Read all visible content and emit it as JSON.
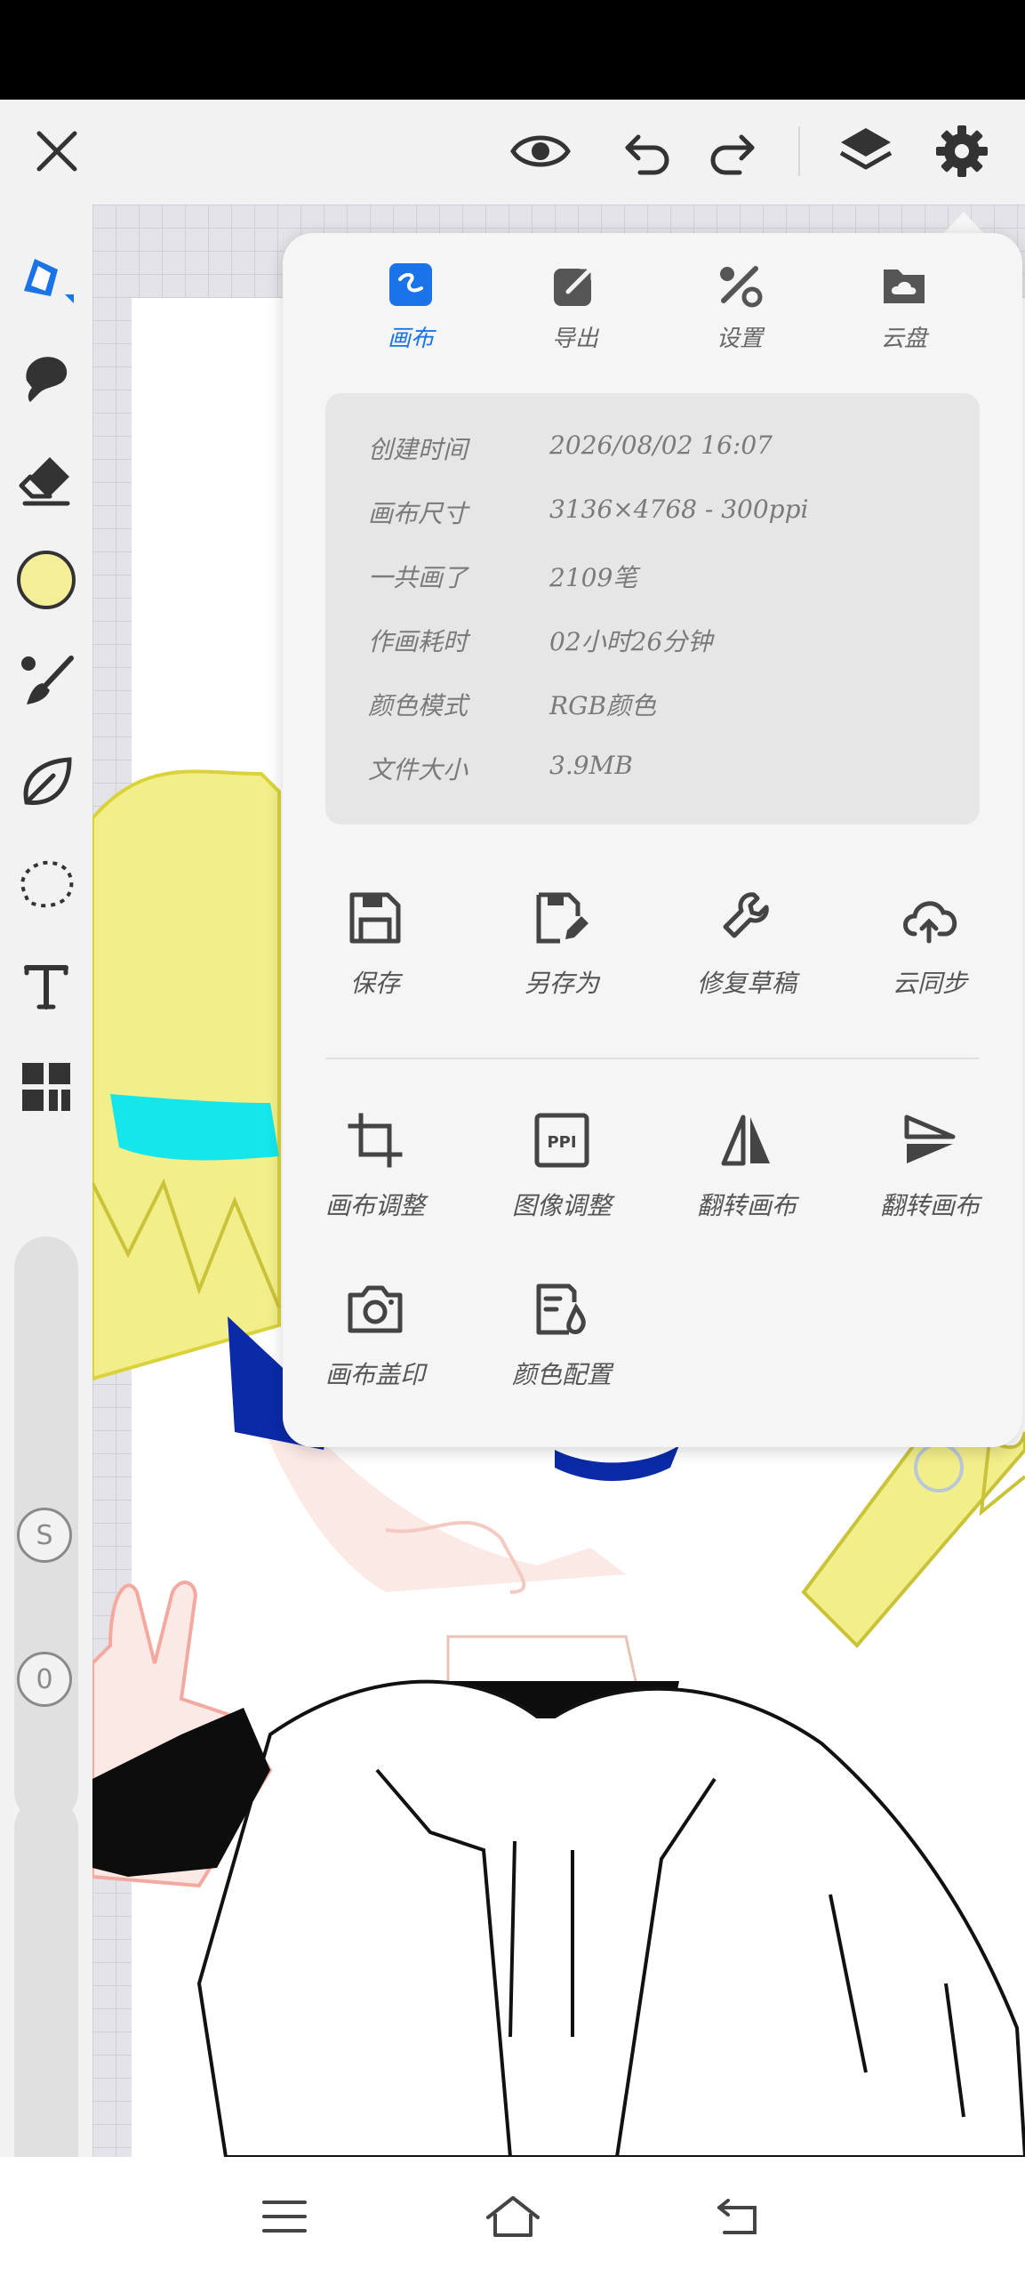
{
  "popup": {
    "tabs": [
      {
        "label": "画布",
        "icon": "canvas-icon",
        "active": true
      },
      {
        "label": "导出",
        "icon": "export-icon"
      },
      {
        "label": "设置",
        "icon": "settings-tools-icon"
      },
      {
        "label": "云盘",
        "icon": "cloud-drive-icon"
      }
    ],
    "info": [
      {
        "key": "创建时间",
        "value": "2026/08/02 16:07"
      },
      {
        "key": "画布尺寸",
        "value": "3136×4768 - 300ppi"
      },
      {
        "key": "一共画了",
        "value": "2109笔"
      },
      {
        "key": "作画耗时",
        "value": "02小时26分钟"
      },
      {
        "key": "颜色模式",
        "value": "RGB颜色"
      },
      {
        "key": "文件大小",
        "value": "3.9MB"
      }
    ],
    "actions_row1": [
      {
        "label": "保存",
        "icon": "save-icon"
      },
      {
        "label": "另存为",
        "icon": "save-as-icon"
      },
      {
        "label": "修复草稿",
        "icon": "wrench-icon"
      },
      {
        "label": "云同步",
        "icon": "cloud-sync-icon"
      }
    ],
    "actions_row2": [
      {
        "label": "画布调整",
        "icon": "crop-icon"
      },
      {
        "label": "图像调整",
        "icon": "ppi-icon"
      },
      {
        "label": "翻转画布",
        "icon": "flip-horizontal-icon"
      },
      {
        "label": "翻转画布",
        "icon": "flip-vertical-icon"
      }
    ],
    "actions_row3": [
      {
        "label": "画布盖印",
        "icon": "camera-icon"
      },
      {
        "label": "颜色配置",
        "icon": "color-profile-icon"
      }
    ]
  },
  "sidebar": {
    "slider_size_badge": "S",
    "slider_opacity_badge": "0",
    "current_color": "#f5ee99"
  },
  "colors": {
    "accent": "#1a73e8",
    "hair": "#f2ee8a",
    "eye": "#0a2aa8",
    "hair_clip": "#14e6ea"
  }
}
